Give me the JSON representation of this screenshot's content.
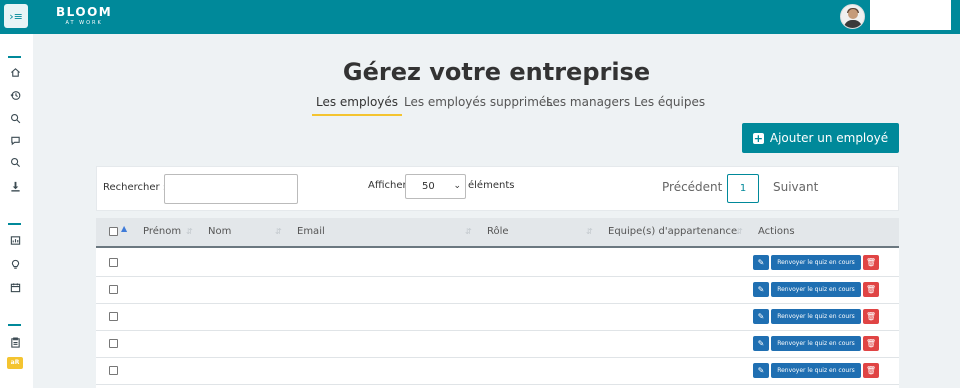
{
  "header": {
    "logo_text": "BLOOM",
    "logo_sub": "AT WORK",
    "accent": "#00899a",
    "brand_yellow": "#f4c430"
  },
  "sidebar": {
    "icons": [
      "home-icon",
      "history-icon",
      "search-settings-icon",
      "chat-icon",
      "discussion-icon",
      "download-icon",
      "report-icon",
      "bulb-icon",
      "calendar-icon",
      "clipboard-icon"
    ],
    "badge": "aR"
  },
  "page": {
    "title": "Gérez votre entreprise",
    "tabs": [
      {
        "label": "Les employés",
        "active": true
      },
      {
        "label": "Les employés supprimés",
        "active": false
      },
      {
        "label": "Les managers",
        "active": false
      },
      {
        "label": "Les équipes",
        "active": false
      }
    ],
    "add_button": "Ajouter un employé"
  },
  "toolbar": {
    "search_label": "Rechercher :",
    "search_value": "",
    "show_label": "Afficher",
    "page_size": "50",
    "elements_label": "éléments",
    "prev": "Précédent",
    "current_page": "1",
    "next": "Suivant"
  },
  "table": {
    "columns": [
      "Prénom",
      "Nom",
      "Email",
      "Rôle",
      "Equipe(s) d'appartenance",
      "Actions"
    ],
    "row_actions": {
      "edit_icon": "pencil-icon",
      "resend_label": "Renvoyer le quiz en cours",
      "delete_icon": "trash-icon"
    },
    "row_count": 5
  }
}
